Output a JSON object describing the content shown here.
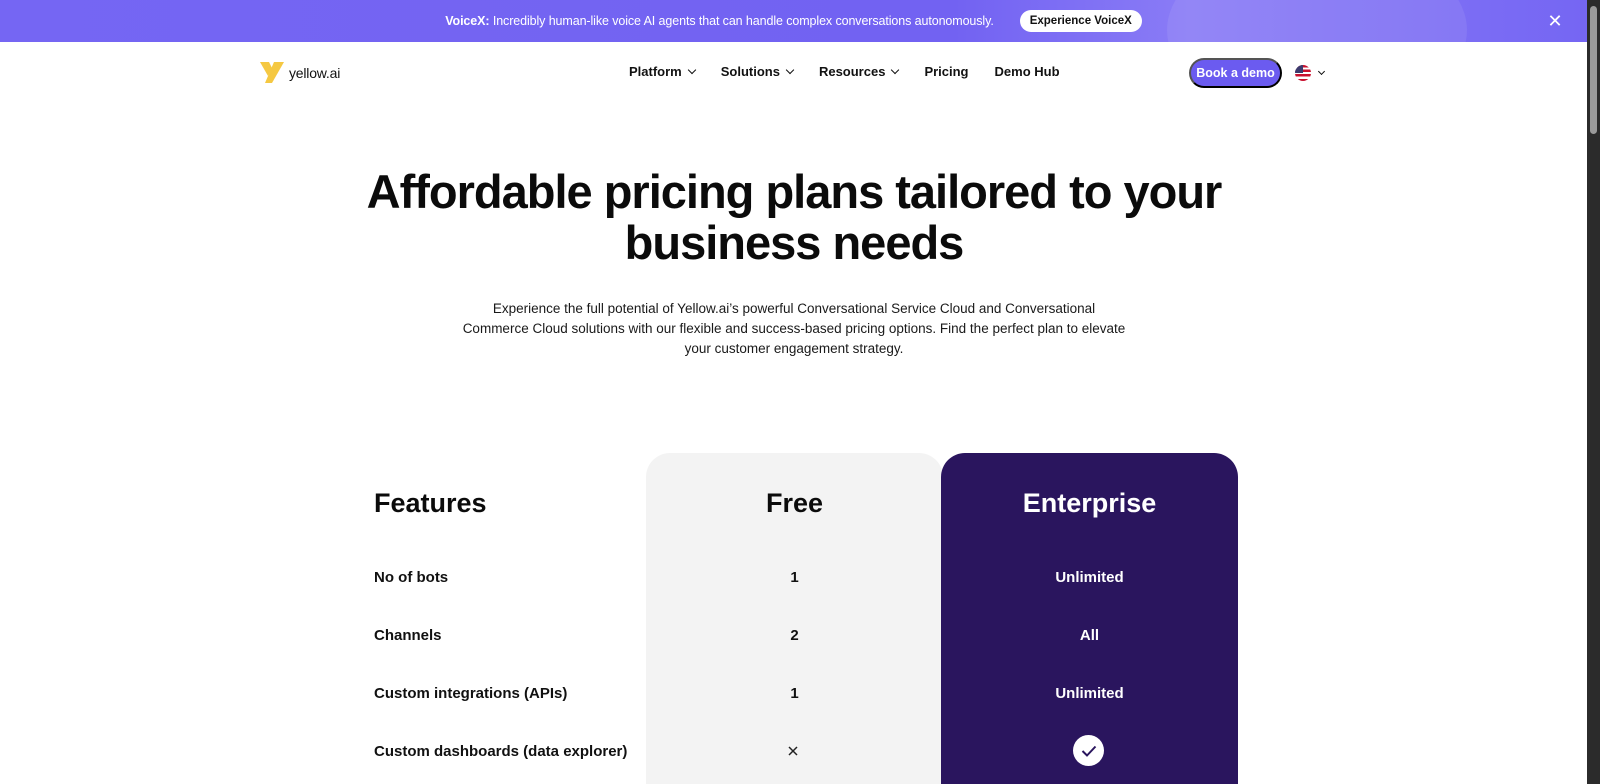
{
  "announcement": {
    "brand": "VoiceX:",
    "message": "Incredibly human-like voice AI agents that can handle complex conversations autonomously.",
    "cta_label": "Experience VoiceX",
    "close_icon": "✕"
  },
  "header": {
    "logo_text": "yellow.ai",
    "nav": [
      {
        "label": "Platform",
        "has_dropdown": true
      },
      {
        "label": "Solutions",
        "has_dropdown": true
      },
      {
        "label": "Resources",
        "has_dropdown": true
      },
      {
        "label": "Pricing",
        "has_dropdown": false
      },
      {
        "label": "Demo Hub",
        "has_dropdown": false
      }
    ],
    "demo_button": "Book a demo",
    "language_icon": "us-flag-icon"
  },
  "hero": {
    "title_line1": "Affordable pricing plans tailored to your",
    "title_line2": "business needs",
    "subtitle": "Experience the full potential of Yellow.ai’s powerful Conversational Service Cloud and Conversational Commerce Cloud solutions with our flexible and success-based pricing options. Find the perfect plan to elevate your customer engagement strategy."
  },
  "pricing": {
    "features_heading": "Features",
    "plans": [
      "Free",
      "Enterprise"
    ],
    "rows": [
      {
        "feature": "No of bots",
        "free": "1",
        "enterprise": "Unlimited"
      },
      {
        "feature": "Channels",
        "free": "2",
        "enterprise": "All"
      },
      {
        "feature": "Custom integrations (APIs)",
        "free": "1",
        "enterprise": "Unlimited"
      },
      {
        "feature": "Custom dashboards (data explorer)",
        "free_icon": "x-icon",
        "enterprise_icon": "check-icon"
      }
    ]
  },
  "colors": {
    "announcement_bg": "#7566f3",
    "primary_button": "#6b5bf0",
    "enterprise_bg": "#2a155e",
    "free_bg": "#f3f3f3",
    "logo_yellow": "#f5c842"
  }
}
